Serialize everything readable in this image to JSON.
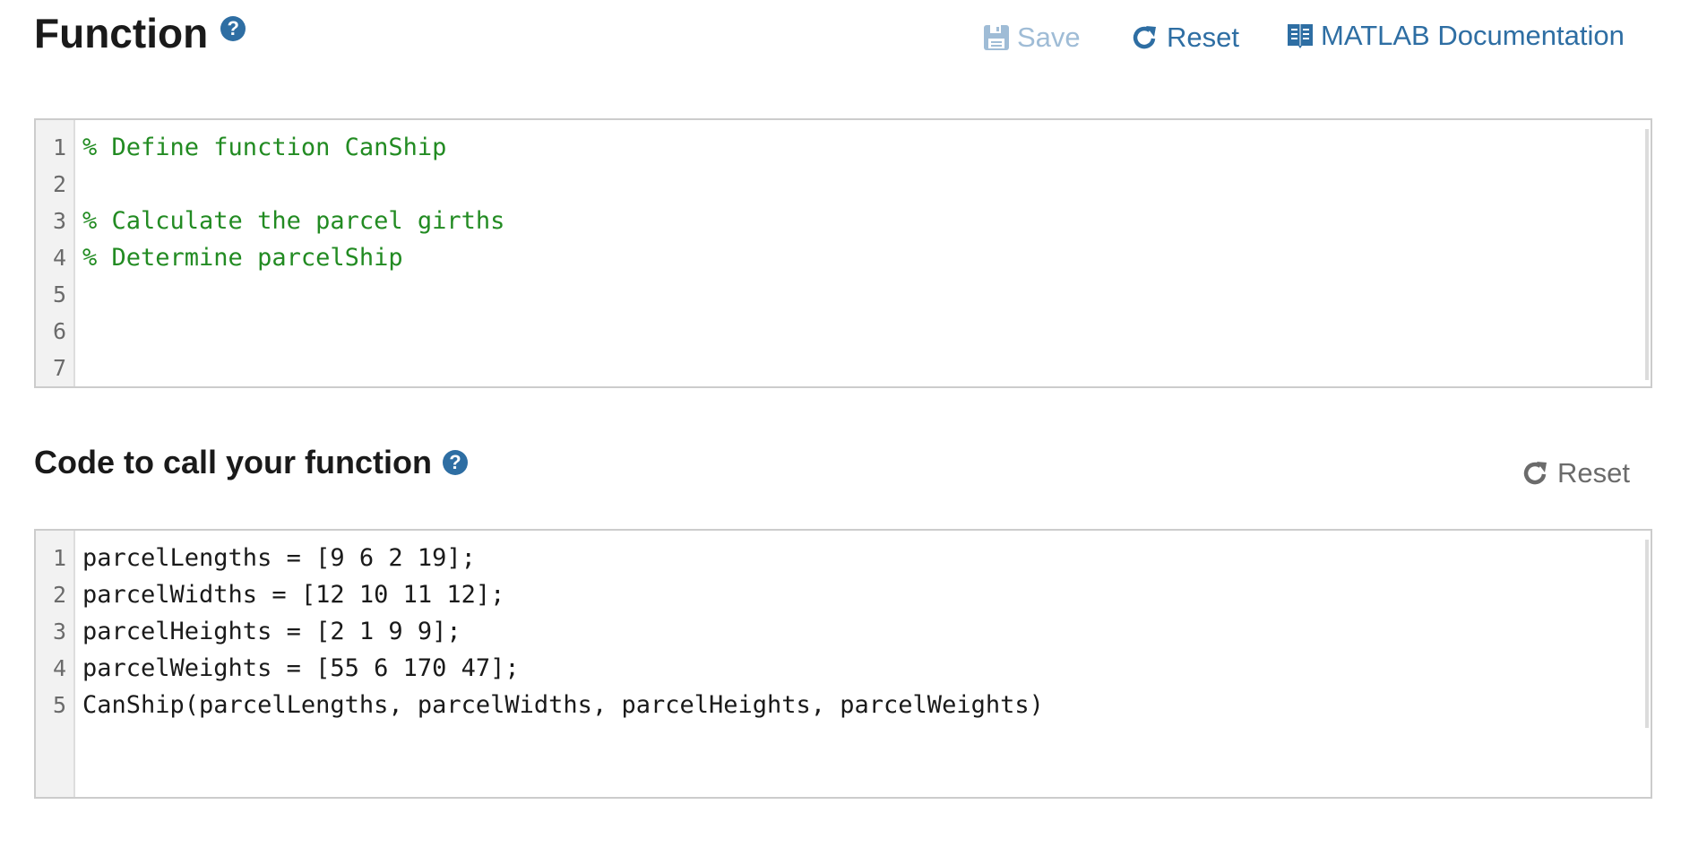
{
  "function_section": {
    "title": "Function",
    "help_icon": "question-circle-icon",
    "toolbar": {
      "save_label": "Save",
      "save_icon": "floppy-disk-icon",
      "save_enabled": false,
      "reset_label": "Reset",
      "reset_icon": "refresh-icon",
      "doc_label": "MATLAB Documentation",
      "doc_icon": "book-icon"
    },
    "editor": {
      "lines": [
        {
          "num": "1",
          "text": "% Define function CanShip",
          "type": "comment"
        },
        {
          "num": "2",
          "text": "",
          "type": "code"
        },
        {
          "num": "3",
          "text": "% Calculate the parcel girths",
          "type": "comment"
        },
        {
          "num": "4",
          "text": "% Determine parcelShip",
          "type": "comment"
        },
        {
          "num": "5",
          "text": "",
          "type": "code"
        },
        {
          "num": "6",
          "text": "",
          "type": "code"
        },
        {
          "num": "7",
          "text": "",
          "type": "code"
        }
      ]
    }
  },
  "call_section": {
    "title": "Code to call your function",
    "help_icon": "question-circle-icon",
    "reset_label": "Reset",
    "reset_icon": "refresh-icon",
    "editor": {
      "lines": [
        {
          "num": "1",
          "text": "parcelLengths = [9 6 2 19];",
          "type": "code"
        },
        {
          "num": "2",
          "text": "parcelWidths = [12 10 11 12];",
          "type": "code"
        },
        {
          "num": "3",
          "text": "parcelHeights = [2 1 9 9];",
          "type": "code"
        },
        {
          "num": "4",
          "text": "parcelWeights = [55 6 170 47];",
          "type": "code"
        },
        {
          "num": "5",
          "text": "CanShip(parcelLengths, parcelWidths, parcelHeights, parcelWeights)",
          "type": "code"
        }
      ]
    }
  },
  "colors": {
    "accent": "#2e6ea3",
    "disabled": "#9fbcd6",
    "comment": "#228b22",
    "muted": "#6b6b6b"
  }
}
